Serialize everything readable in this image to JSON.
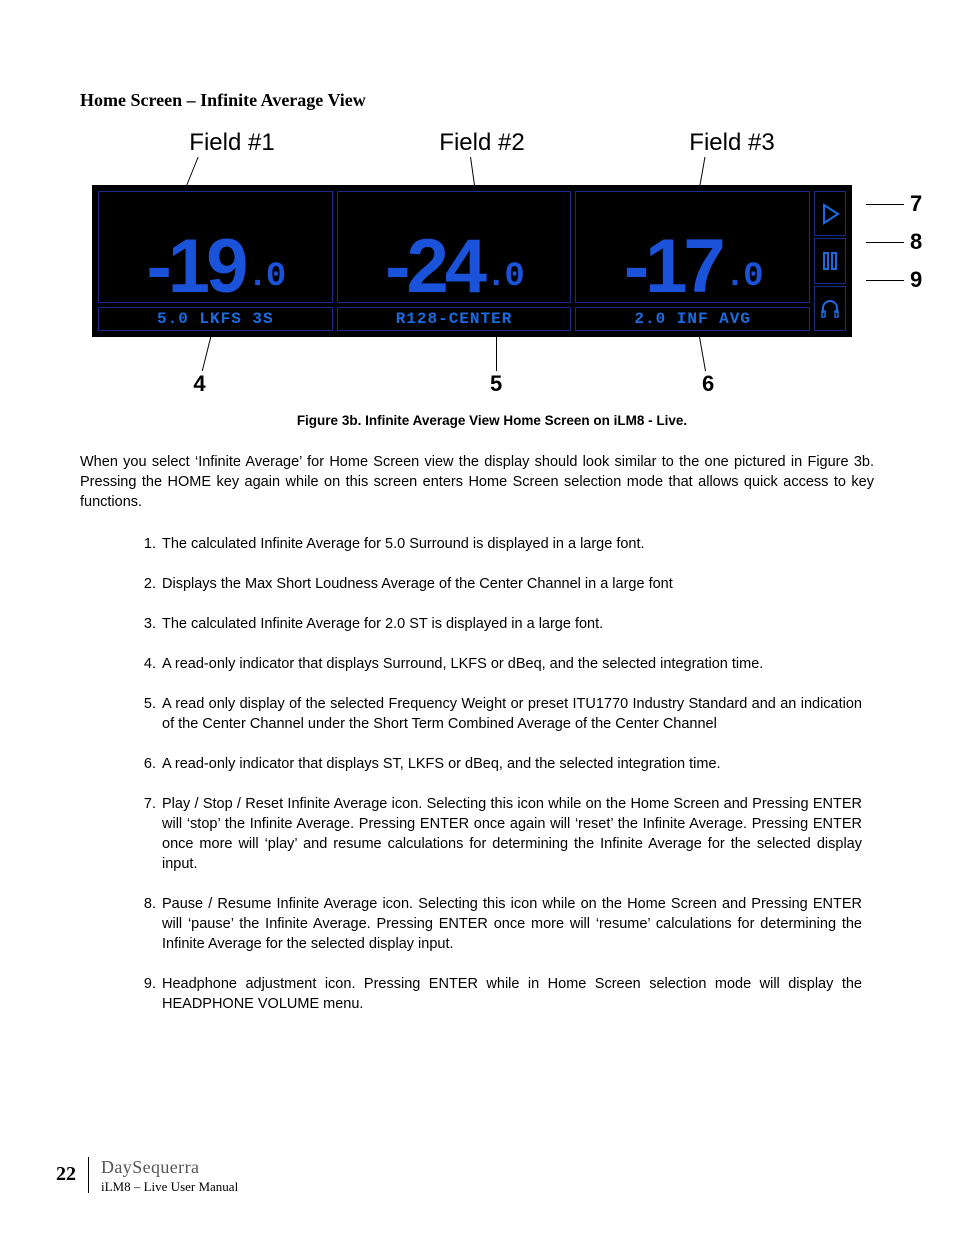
{
  "section_title": "Home Screen – Infinite Average View",
  "figure": {
    "field_labels": [
      "Field #1",
      "Field #2",
      "Field #3"
    ],
    "fields": [
      {
        "big_int": "-19",
        "big_dec": ".0",
        "small": "5.0 LKFS 3S"
      },
      {
        "big_int": "-24",
        "big_dec": ".0",
        "small": "R128-CENTER"
      },
      {
        "big_int": "-17",
        "big_dec": ".0",
        "small": "2.0 INF AVG"
      }
    ],
    "right_callouts": [
      "7",
      "8",
      "9"
    ],
    "bottom_callouts": [
      "4",
      "5",
      "6"
    ],
    "caption": "Figure 3b.    Infinite Average View Home Screen on iLM8 - Live."
  },
  "intro": "When you select ‘Infinite Average’ for Home Screen view the display should look similar to the one pictured in Figure 3b.  Pressing the HOME key again while on this screen enters Home Screen selection mode that allows quick access to key functions.",
  "list": [
    "The calculated Infinite Average for 5.0 Surround is displayed in a large font.",
    "Displays the Max Short Loudness Average of the Center Channel in a large font",
    "The calculated Infinite Average for 2.0 ST is displayed in a large font.",
    "A read-only indicator that displays Surround, LKFS or dBeq, and the selected integration time.",
    "A read only display of the selected Frequency Weight or preset ITU1770 Industry Standard and an indication of the Center Channel under the Short Term Combined Average of the Center Channel",
    "A read-only indicator that displays ST, LKFS or dBeq, and the selected integration time.",
    "Play / Stop / Reset Infinite Average icon. Selecting this icon while on the Home Screen and Pressing ENTER will ‘stop’ the Infinite Average.  Pressing ENTER once again will ‘reset’ the Infinite Average.  Pressing ENTER once more will ‘play’ and resume calculations for determining the Infinite Average for the selected display input.",
    "Pause / Resume Infinite Average icon.  Selecting this icon while on the Home Screen and Pressing ENTER will ‘pause’ the Infinite Average.  Pressing ENTER once more will ‘resume’ calculations for determining the Infinite Average for the selected display input.",
    "Headphone adjustment icon. Pressing ENTER while in Home Screen selection mode will display the HEADPHONE VOLUME menu."
  ],
  "footer": {
    "page_number": "22",
    "brand": "DaySequerra",
    "manual": "iLM8 – Live User Manual"
  }
}
